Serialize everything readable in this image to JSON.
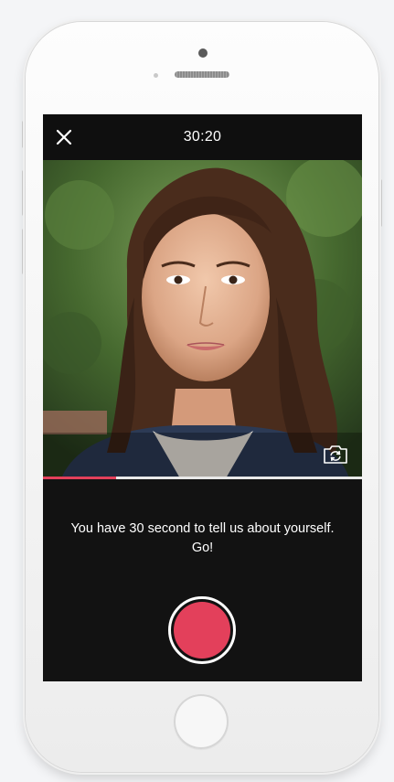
{
  "app": {
    "timer": "30:20",
    "prompt": "You have 30 second to tell us about yourself. Go!",
    "progress_fraction": 0.23
  },
  "icons": {
    "close": "close-icon",
    "switch_camera": "switch-camera-icon",
    "record": "record-button"
  },
  "colors": {
    "accent": "#e3405b",
    "screen_background": "#121212",
    "text": "#ffffff"
  }
}
